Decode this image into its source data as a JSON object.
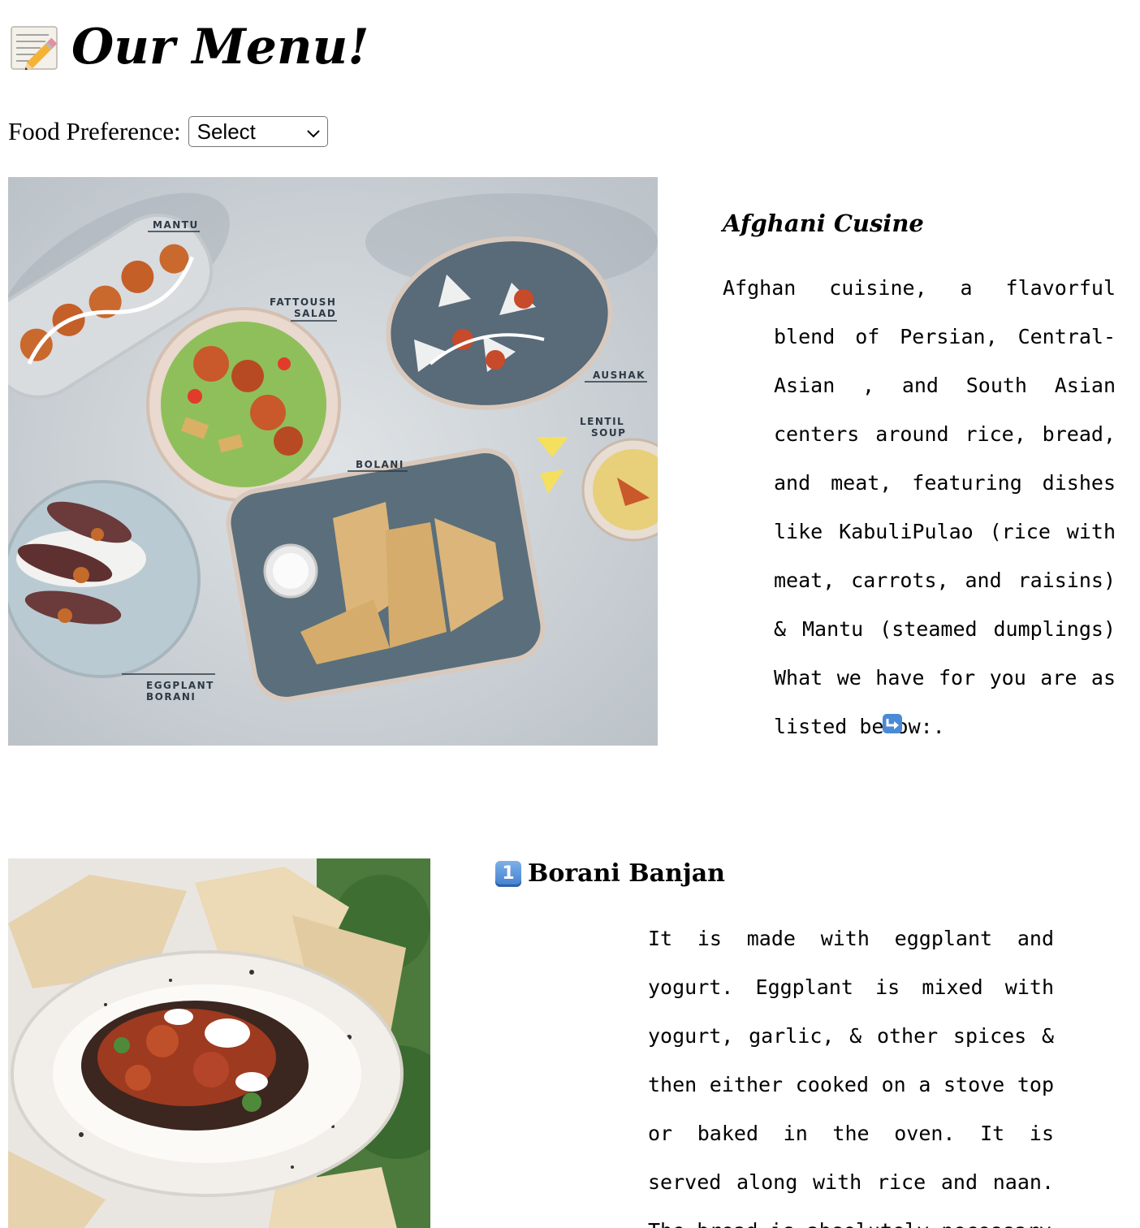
{
  "header": {
    "title": "Our Menu!",
    "title_icon": "memo-pencil-icon"
  },
  "preference": {
    "label": "Food Preference:",
    "selected": "Select"
  },
  "hero": {
    "image_labels": [
      "MANTU",
      "FATTOUSH SALAD",
      "AUSHAK",
      "LENTIL SOUP",
      "BOLANI",
      "EGGPLANT BORANI"
    ],
    "cuisine_title": "Afghani Cusine",
    "cuisine_text": "Afghan cuisine, a flavorful blend of Persian, Central-Asian , and South Asian centers around rice, bread, and meat, featuring dishes like KabuliPulao (rice with meat, carrots, and raisins) & Mantu (steamed dumplings) What we have for you are as listed below:",
    "cuisine_text_end_icon": "arrow-down-right-icon",
    "cuisine_text_end": "."
  },
  "dishes": [
    {
      "number": "1",
      "name": "Borani Banjan",
      "description": "It is made with eggplant and yogurt. Eggplant is mixed with yogurt, garlic, & other spices & then either cooked on a stove top or baked in the oven. It is served along with rice and naan. The bread is absolutely necessary"
    }
  ],
  "colors": {
    "text": "#000000",
    "select_border": "#767676",
    "keycap_blue": "#3f7fcf"
  }
}
